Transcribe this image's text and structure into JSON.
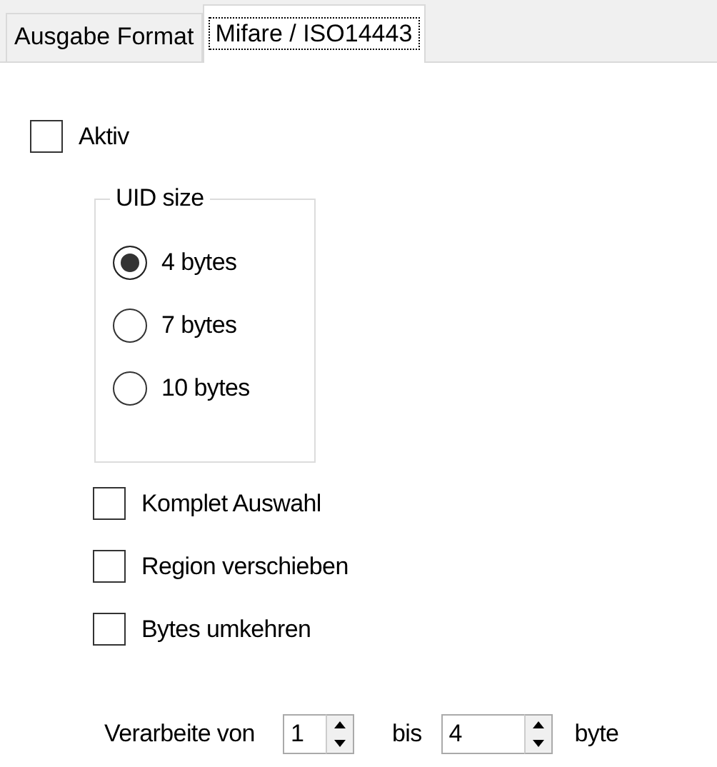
{
  "tabs": [
    {
      "label": "Ausgabe Format",
      "selected": false
    },
    {
      "label": "Mifare / ISO14443",
      "selected": true
    }
  ],
  "aktiv": {
    "label": "Aktiv",
    "checked": false
  },
  "uid_size": {
    "title": "UID size",
    "options": [
      {
        "label": "4 bytes",
        "selected": true
      },
      {
        "label": "7 bytes",
        "selected": false
      },
      {
        "label": "10 bytes",
        "selected": false
      }
    ]
  },
  "options": [
    {
      "label": "Komplet Auswahl",
      "checked": false
    },
    {
      "label": "Region verschieben",
      "checked": false
    },
    {
      "label": "Bytes umkehren",
      "checked": false
    }
  ],
  "range": {
    "from_label": "Verarbeite von",
    "from_value": "1",
    "to_label": "bis",
    "to_value": "4",
    "unit": "byte"
  }
}
